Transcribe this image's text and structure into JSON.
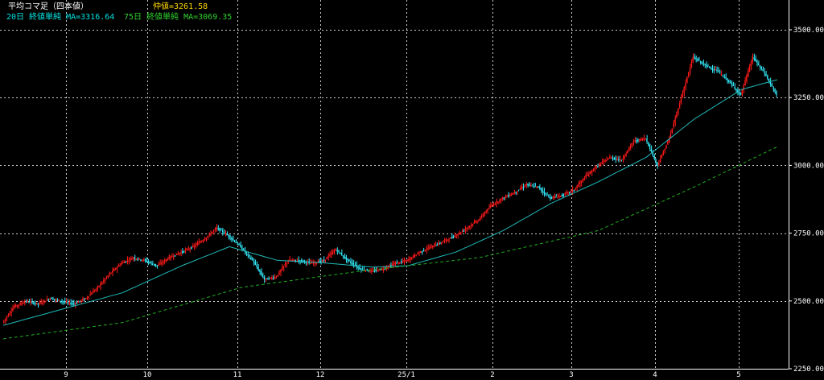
{
  "header": {
    "title": "平均コマ足（四本値）",
    "mid_value": "仲値=3261.58",
    "ma20": "20日 終値単純 MA=3316.64",
    "ma75": "75日 終値単純 MA=3069.35"
  },
  "colors": {
    "up": "#ff1a1a",
    "down": "#33eeff",
    "ma20": "#20b8b8",
    "ma75": "#22aa22",
    "grid": "#ffffff",
    "background": "#000000"
  },
  "chart_data": {
    "type": "candlestick",
    "y_range": [
      2250,
      3550
    ],
    "y_ticks": [
      "3500.00",
      "3250.00",
      "3000.00",
      "2750.00",
      "2500.00",
      "2250.00"
    ],
    "y_tick_values": [
      3500,
      3250,
      3000,
      2750,
      2500,
      2250
    ],
    "x_ticks": [
      "9",
      "10",
      "11",
      "12",
      "25/1",
      "2",
      "3",
      "4",
      "5"
    ],
    "grid": "dotted",
    "price_path": [
      [
        0,
        2420
      ],
      [
        8,
        2480
      ],
      [
        16,
        2500
      ],
      [
        24,
        2490
      ],
      [
        32,
        2510
      ],
      [
        40,
        2500
      ],
      [
        48,
        2490
      ],
      [
        56,
        2510
      ],
      [
        64,
        2550
      ],
      [
        72,
        2600
      ],
      [
        80,
        2640
      ],
      [
        88,
        2660
      ],
      [
        96,
        2650
      ],
      [
        104,
        2630
      ],
      [
        112,
        2660
      ],
      [
        120,
        2680
      ],
      [
        128,
        2700
      ],
      [
        136,
        2730
      ],
      [
        144,
        2770
      ],
      [
        152,
        2740
      ],
      [
        160,
        2700
      ],
      [
        168,
        2650
      ],
      [
        176,
        2580
      ],
      [
        184,
        2590
      ],
      [
        192,
        2650
      ],
      [
        200,
        2650
      ],
      [
        208,
        2640
      ],
      [
        216,
        2650
      ],
      [
        224,
        2690
      ],
      [
        232,
        2650
      ],
      [
        240,
        2620
      ],
      [
        248,
        2610
      ],
      [
        256,
        2620
      ],
      [
        264,
        2640
      ],
      [
        272,
        2650
      ],
      [
        280,
        2680
      ],
      [
        288,
        2700
      ],
      [
        296,
        2720
      ],
      [
        304,
        2740
      ],
      [
        312,
        2770
      ],
      [
        320,
        2800
      ],
      [
        328,
        2850
      ],
      [
        336,
        2880
      ],
      [
        344,
        2900
      ],
      [
        352,
        2930
      ],
      [
        360,
        2920
      ],
      [
        368,
        2880
      ],
      [
        376,
        2890
      ],
      [
        384,
        2910
      ],
      [
        392,
        2960
      ],
      [
        400,
        3000
      ],
      [
        408,
        3030
      ],
      [
        416,
        3020
      ],
      [
        424,
        3090
      ],
      [
        432,
        3100
      ],
      [
        440,
        3000
      ],
      [
        448,
        3100
      ],
      [
        456,
        3250
      ],
      [
        464,
        3400
      ],
      [
        472,
        3370
      ],
      [
        480,
        3350
      ],
      [
        488,
        3310
      ],
      [
        496,
        3260
      ],
      [
        504,
        3400
      ],
      [
        512,
        3340
      ],
      [
        520,
        3260
      ]
    ],
    "ma20_path": [
      [
        0,
        2410
      ],
      [
        40,
        2470
      ],
      [
        80,
        2530
      ],
      [
        120,
        2630
      ],
      [
        152,
        2700
      ],
      [
        184,
        2650
      ],
      [
        216,
        2640
      ],
      [
        248,
        2625
      ],
      [
        272,
        2630
      ],
      [
        304,
        2680
      ],
      [
        336,
        2760
      ],
      [
        368,
        2860
      ],
      [
        400,
        2940
      ],
      [
        432,
        3030
      ],
      [
        464,
        3170
      ],
      [
        496,
        3280
      ],
      [
        520,
        3316
      ]
    ],
    "ma75_path": [
      [
        0,
        2360
      ],
      [
        80,
        2420
      ],
      [
        160,
        2550
      ],
      [
        240,
        2610
      ],
      [
        320,
        2660
      ],
      [
        400,
        2760
      ],
      [
        464,
        2920
      ],
      [
        520,
        3069
      ]
    ]
  }
}
